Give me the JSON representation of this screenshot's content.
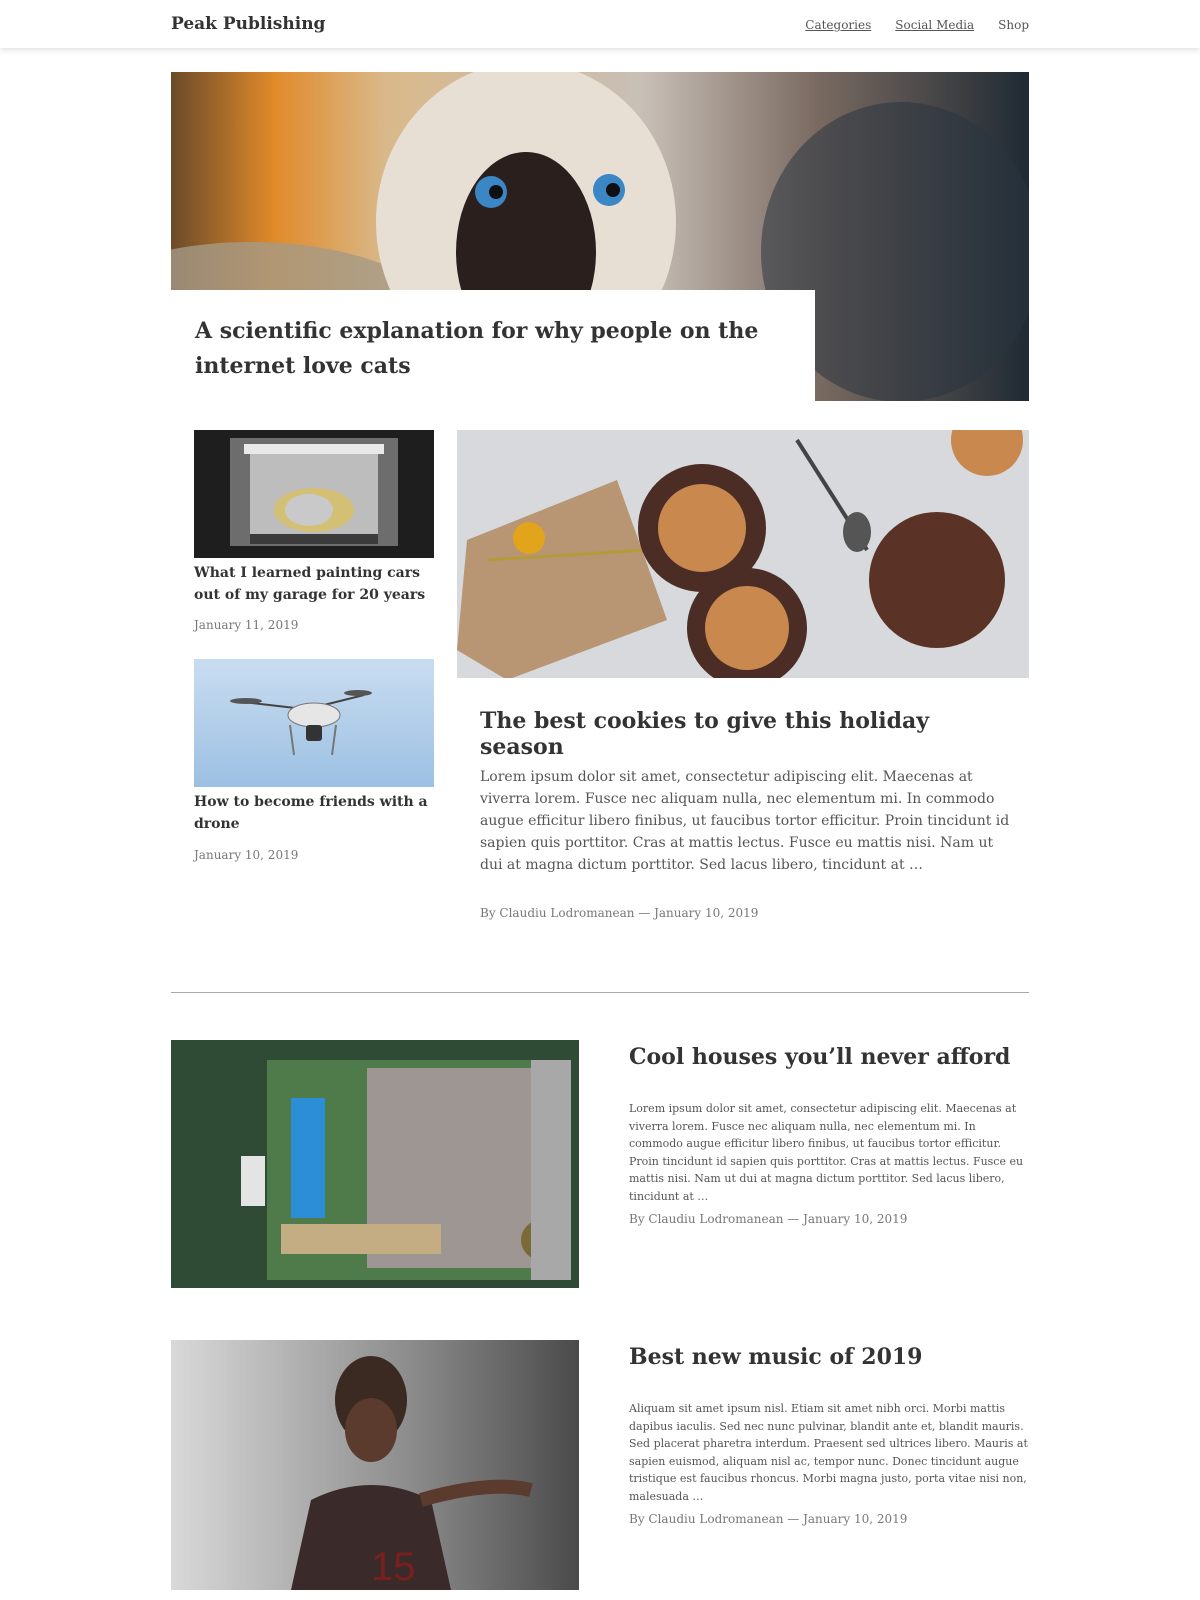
{
  "header": {
    "brand": "Peak Publishing",
    "nav": [
      "Categories",
      "Social Media",
      "Shop"
    ]
  },
  "hero": {
    "title": "A scientific explanation for why people on the internet love cats",
    "image": "cat-photo"
  },
  "cards": [
    {
      "title": "What I learned painting cars out of my garage for 20 years",
      "date": "January 11, 2019",
      "image": "garage-car-photo"
    },
    {
      "title": "How to become friends with a drone",
      "date": "January 10, 2019",
      "image": "drone-photo"
    }
  ],
  "featured": {
    "title": "The best cookies to give this holiday season",
    "excerpt": "Lorem ipsum dolor sit amet, consectetur adipiscing elit. Maecenas at viverra lorem. Fusce nec aliquam nulla, nec elementum mi. In commodo augue efficitur libero finibus, ut faucibus tortor efficitur. Proin tincidunt id sapien quis porttitor. Cras at mattis lectus. Fusce eu mattis nisi. Nam ut dui at magna dictum porttitor. Sed lacus libero, tincidunt at …",
    "meta": "By Claudiu Lodromanean — January 10, 2019",
    "image": "cookies-photo"
  },
  "list": [
    {
      "title": "Cool houses you’ll never afford",
      "excerpt": "Lorem ipsum dolor sit amet, consectetur adipiscing elit. Maecenas at viverra lorem. Fusce nec aliquam nulla, nec elementum mi. In commodo augue efficitur libero finibus, ut faucibus tortor efficitur. Proin tincidunt id sapien quis porttitor. Cras at mattis lectus. Fusce eu mattis nisi. Nam ut dui at magna dictum porttitor. Sed lacus libero, tincidunt at …",
      "meta": "By Claudiu Lodromanean — January 10, 2019",
      "image": "aerial-house-photo"
    },
    {
      "title": "Best new music of 2019",
      "excerpt": "Aliquam sit amet ipsum nisl. Etiam sit amet nibh orci. Morbi mattis dapibus iaculis. Sed nec nunc pulvinar, blandit ante et, blandit mauris. Sed placerat pharetra interdum. Praesent sed ultrices libero. Mauris at sapien euismod, aliquam nisl ac, tempor nunc. Donec tincidunt augue tristique est faucibus rhoncus. Morbi magna justo, porta vitae nisi non, malesuada …",
      "meta": "By Claudiu Lodromanean — January 10, 2019",
      "image": "musician-photo"
    }
  ]
}
